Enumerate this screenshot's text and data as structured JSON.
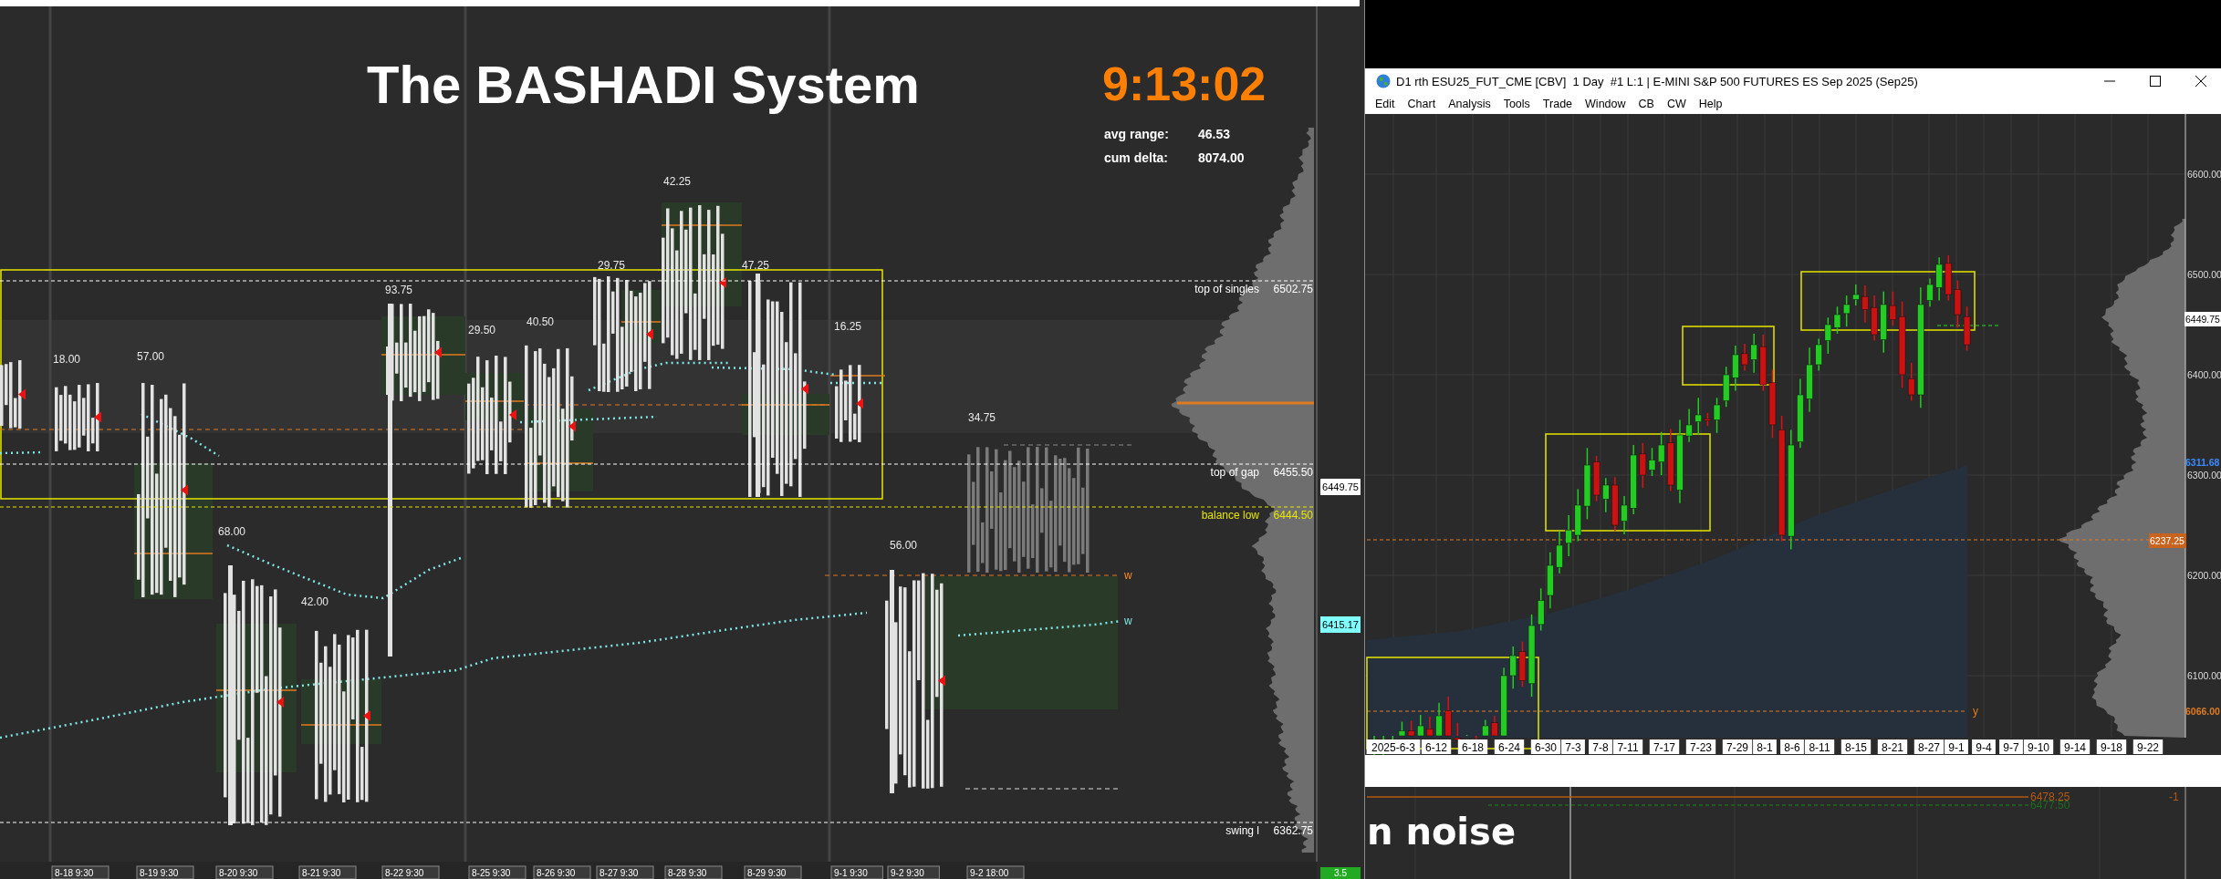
{
  "left_chart": {
    "title": "The BASHADI System",
    "clock": "9:13:02",
    "stats": [
      {
        "label": "avg range:",
        "value": "46.53"
      },
      {
        "label": "cum delta:",
        "value": "8074.00"
      }
    ],
    "range_labels": [
      "42.25",
      "29.75",
      "47.25",
      "93.75",
      "18.00",
      "57.00",
      "29.50",
      "40.50",
      "16.25",
      "34.75",
      "68.00",
      "42.00",
      "56.00"
    ],
    "levels": [
      {
        "label": "top of singles",
        "price": "6502.75",
        "color": "#ffffff"
      },
      {
        "label": "top of gap",
        "price": "6455.50",
        "color": "#ffffff"
      },
      {
        "label": "balance low",
        "price": "6444.50",
        "color": "#e6e600"
      },
      {
        "label": "swing l",
        "price": "6362.75",
        "color": "#ffffff"
      }
    ],
    "session_marks": [
      {
        "text": "w",
        "color": "#ff8c1a"
      },
      {
        "text": "w",
        "color": "#7fe5e5"
      }
    ],
    "price_tags": [
      {
        "text": "6449.75",
        "kind": "box",
        "color": "#ffffff"
      },
      {
        "text": "6415.17",
        "kind": "box",
        "color": "#7fffff"
      }
    ],
    "time_axis": [
      "8-18  9:30",
      "8-19  9:30",
      "8-20  9:30",
      "8-21  9:30",
      "8-22  9:30",
      "8-25  9:30",
      "8-26  9:30",
      "8-27  9:30",
      "8-28  9:30",
      "8-29  9:30",
      "9-1  9:30",
      "9-2  9:30",
      "9-2  18:00"
    ],
    "corner_tag": "3.5"
  },
  "chart_window": {
    "title": "D1 rth ESU25_FUT_CME [CBV]  1 Day  #1 L:1 | E-MINI S&P 500 FUTURES ES Sep 2025 (Sep25)",
    "menu": [
      "Edit",
      "Chart",
      "Analysis",
      "Tools",
      "Trade",
      "Window",
      "CB",
      "CW",
      "Help"
    ],
    "y_axis": [
      "6600.00",
      "6500.00",
      "6400.00",
      "6300.00",
      "6200.00",
      "6100.00"
    ],
    "price_tags": [
      {
        "text": "6449.75",
        "kind": "box",
        "color": "#ffffff"
      },
      {
        "text": "6311.68",
        "kind": "plain",
        "color": "#3d8bff"
      },
      {
        "text": "6237.25",
        "kind": "box",
        "color": "#c8641e"
      },
      {
        "text": "6066.00",
        "kind": "plain",
        "color": "#e07a20"
      }
    ],
    "level_mark": "y",
    "date_axis": [
      "2025-6-3",
      "6-12",
      "6-18",
      "6-24",
      "6-30",
      "7-3",
      "7-8",
      "7-11",
      "7-17",
      "7-23",
      "7-29",
      "8-1",
      "8-6",
      "8-11",
      "8-15",
      "8-21",
      "8-27",
      "9-1",
      "9-4",
      "9-7",
      "9-10",
      "9-14",
      "9-18",
      "9-22"
    ]
  },
  "lower_panel": {
    "title": "n noise",
    "levels": [
      {
        "text": "6478.25",
        "color": "#b35a10"
      },
      {
        "text": "6477.50",
        "color": "#1e6b1e"
      }
    ],
    "value": "-1"
  }
}
